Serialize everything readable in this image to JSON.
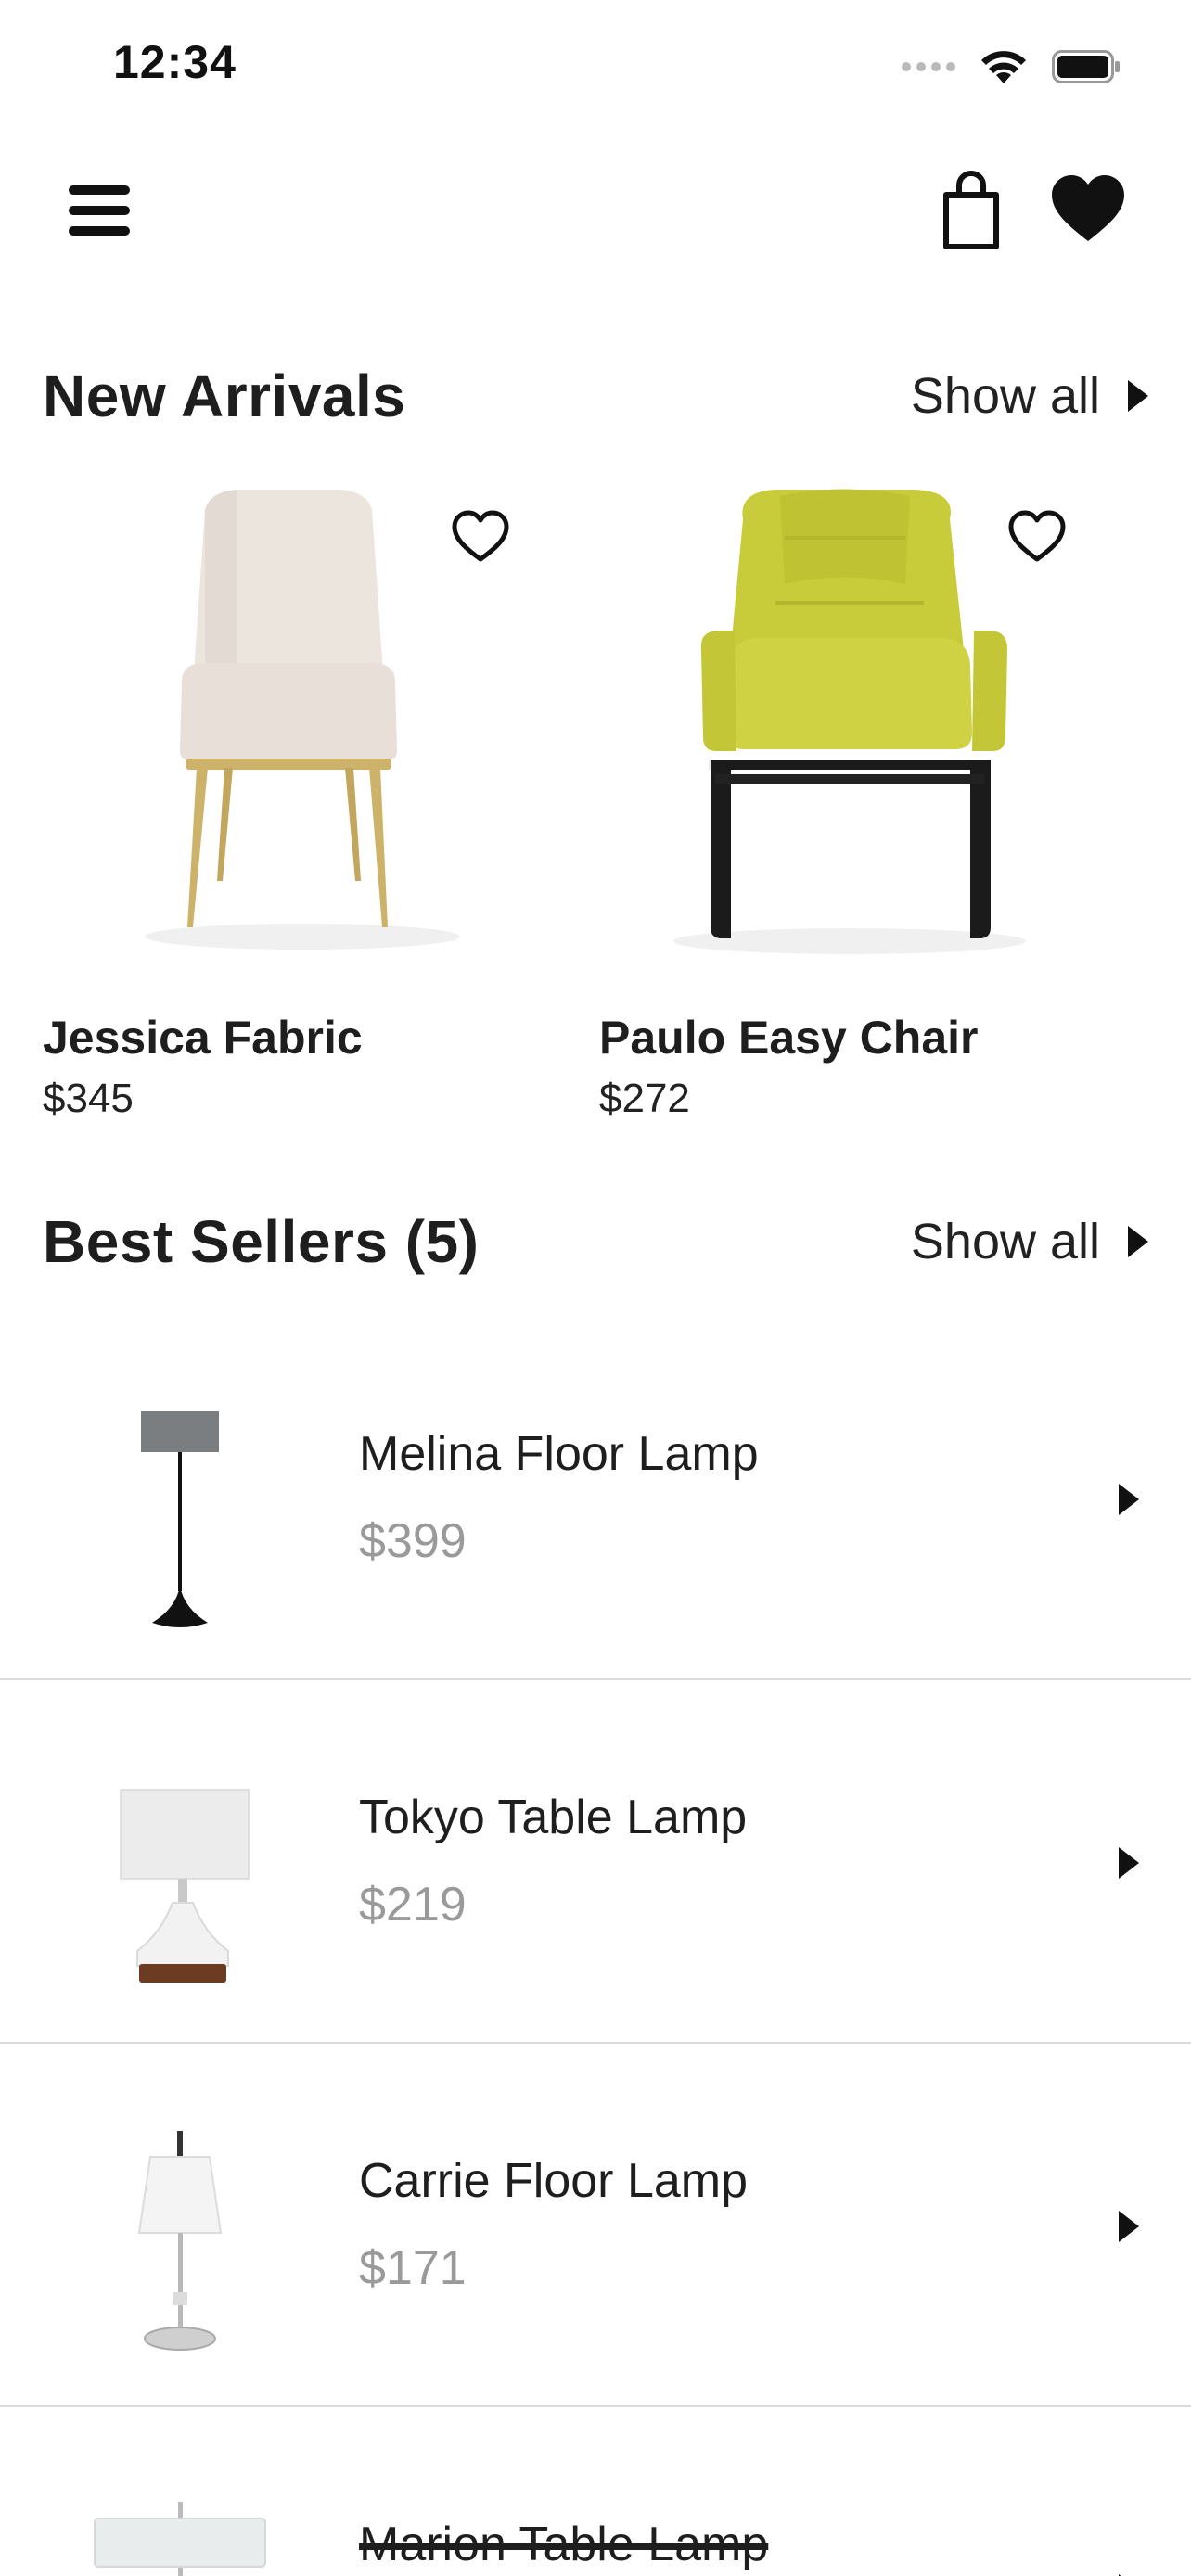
{
  "status_bar": {
    "time": "12:34"
  },
  "nav": {
    "menu_icon": "hamburger-menu-icon",
    "cart_icon": "shopping-bag-icon",
    "favorites_icon": "heart-filled-icon"
  },
  "new_arrivals": {
    "title": "New Arrivals",
    "show_all": "Show all",
    "items": [
      {
        "name": "Jessica Fabric",
        "price": "$345",
        "image": "beige-fabric-chair",
        "fav_icon": "heart-outline-icon"
      },
      {
        "name": "Paulo Easy Chair",
        "price": "$272",
        "image": "yellow-easy-chair",
        "fav_icon": "heart-outline-icon"
      }
    ]
  },
  "best_sellers": {
    "title": "Best Sellers (5)",
    "show_all": "Show all",
    "items": [
      {
        "name": "Melina Floor Lamp",
        "price": "$399",
        "image": "grey-floor-lamp"
      },
      {
        "name": "Tokyo Table Lamp",
        "price": "$219",
        "image": "white-table-lamp"
      },
      {
        "name": "Carrie Floor Lamp",
        "price": "$171",
        "image": "white-chrome-floor-lamp"
      },
      {
        "name": "Marion Table Lamp",
        "price": "",
        "image": "white-pendant-table-lamp"
      }
    ]
  },
  "colors": {
    "text": "#1e1e1e",
    "muted_price": "#9a9a9a",
    "divider": "#dcdcdc",
    "chair_beige": "#ebe3dc",
    "chair_yellow": "#c9cc3a",
    "gold": "#cdb26a"
  }
}
